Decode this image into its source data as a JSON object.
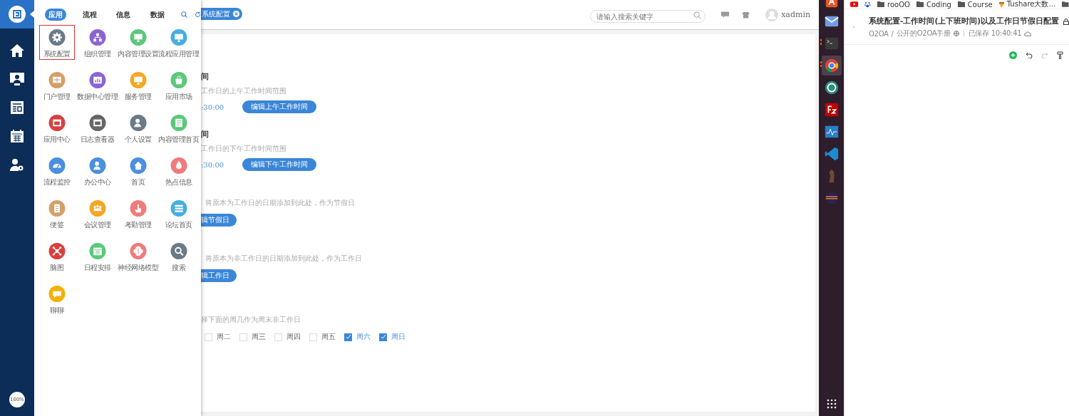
{
  "nav": {
    "zoom": "100%"
  },
  "app_menu": {
    "tabs": [
      {
        "label": "应用",
        "selected": true
      },
      {
        "label": "流程",
        "selected": false
      },
      {
        "label": "信息",
        "selected": false
      },
      {
        "label": "数据",
        "selected": false
      }
    ],
    "apps": [
      {
        "label": "系统配置",
        "kind": "gear",
        "color": "#6b7a87",
        "selected": true
      },
      {
        "label": "组织管理",
        "kind": "org",
        "color": "#8c63d6",
        "selected": false
      },
      {
        "label": "内容管理设置",
        "kind": "monitor",
        "color": "#5cc87a",
        "selected": false
      },
      {
        "label": "流程应用管理",
        "kind": "monitor",
        "color": "#45aee0",
        "selected": false
      },
      {
        "label": "门户管理",
        "kind": "grid",
        "color": "#d4a06a",
        "selected": false
      },
      {
        "label": "数据中心管理",
        "kind": "chart",
        "color": "#8c63d6",
        "selected": false
      },
      {
        "label": "服务管理",
        "kind": "monitor",
        "color": "#f5a623",
        "selected": false
      },
      {
        "label": "应用市场",
        "kind": "bag",
        "color": "#5cc87a",
        "selected": false
      },
      {
        "label": "应用中心",
        "kind": "window",
        "color": "#d84040",
        "selected": false
      },
      {
        "label": "日志查看器",
        "kind": "window",
        "color": "#666666",
        "selected": false
      },
      {
        "label": "个人设置",
        "kind": "person",
        "color": "#6b7a87",
        "selected": false
      },
      {
        "label": "内容管理首页",
        "kind": "doc",
        "color": "#5cc87a",
        "selected": false
      },
      {
        "label": "流程监控",
        "kind": "gauge",
        "color": "#4a8fe0",
        "selected": false
      },
      {
        "label": "办公中心",
        "kind": "person",
        "color": "#4a8fe0",
        "selected": false
      },
      {
        "label": "首页",
        "kind": "home",
        "color": "#4a8fe0",
        "selected": false
      },
      {
        "label": "热点信息",
        "kind": "flame",
        "color": "#f07b7b",
        "selected": false
      },
      {
        "label": "便签",
        "kind": "note",
        "color": "#d4a06a",
        "selected": false
      },
      {
        "label": "会议管理",
        "kind": "people",
        "color": "#f5a623",
        "selected": false
      },
      {
        "label": "考勤管理",
        "kind": "hand",
        "color": "#f07b7b",
        "selected": false
      },
      {
        "label": "论坛首页",
        "kind": "list",
        "color": "#45aee0",
        "selected": false
      },
      {
        "label": "脑图",
        "kind": "network",
        "color": "#d84040",
        "selected": false
      },
      {
        "label": "日程安排",
        "kind": "calendar",
        "color": "#5cc87a",
        "selected": false
      },
      {
        "label": "神经网络模型",
        "kind": "brain",
        "color": "#f07b7b",
        "selected": false
      },
      {
        "label": "搜索",
        "kind": "search",
        "color": "#6b7a87",
        "selected": false
      },
      {
        "label": "聊聊",
        "kind": "chat",
        "color": "#f5b000",
        "selected": false
      }
    ]
  },
  "topbar": {
    "tab": "系统配置",
    "search": {
      "placeholder": "请输入搜索关键字"
    },
    "user": "xadmin"
  },
  "sections": [
    {
      "kind": "time",
      "heading": "间",
      "hint": "工作日的上午工作时间范围",
      "value": ":30:00",
      "button": "编辑上午工作时间"
    },
    {
      "kind": "time",
      "heading": "间",
      "hint": "工作日的下午工作时间范围",
      "value": ":30:00",
      "button": "编辑下午工作时间"
    },
    {
      "kind": "dates",
      "hint": "将原本为工作日的日期添加到此处，作为节假日",
      "button": "辑节假日"
    },
    {
      "kind": "dates",
      "hint": "将原本为非工作日的日期添加到此处，作为工作日",
      "button": "辑工作日"
    },
    {
      "kind": "weekdays",
      "hint": "择下面的周几作为周末非工作日",
      "days": [
        {
          "label": "周二",
          "checked": false
        },
        {
          "label": "周三",
          "checked": false
        },
        {
          "label": "周四",
          "checked": false
        },
        {
          "label": "周五",
          "checked": false
        },
        {
          "label": "周六",
          "checked": true
        },
        {
          "label": "周日",
          "checked": true
        }
      ]
    }
  ],
  "dock": [
    {
      "kind": "store",
      "running": false,
      "selected": false
    },
    {
      "kind": "mail",
      "running": false,
      "selected": false
    },
    {
      "kind": "terminal",
      "running": true,
      "selected": false
    },
    {
      "kind": "browser",
      "running": true,
      "selected": true
    },
    {
      "kind": "sync",
      "running": false,
      "selected": false
    },
    {
      "kind": "transfer",
      "running": false,
      "selected": false
    },
    {
      "kind": "monitor",
      "running": false,
      "selected": false
    },
    {
      "kind": "editor",
      "running": false,
      "selected": false
    },
    {
      "kind": "animal",
      "running": false,
      "selected": false
    },
    {
      "kind": "ring",
      "running": false,
      "selected": false
    }
  ],
  "browser": {
    "bookmarks": [
      {
        "kind": "video"
      },
      {
        "kind": "paw"
      },
      {
        "kind": "folder",
        "label": "rooOO"
      },
      {
        "kind": "folder",
        "label": "Coding"
      },
      {
        "kind": "folder",
        "label": "Course"
      },
      {
        "kind": "acorn",
        "label": "Tushare大数…"
      },
      {
        "kind": "folder"
      }
    ],
    "doc": {
      "title": "系统配置-工作时间(上下班时间)以及工作日节假日配置",
      "space": "O2OA",
      "separator": "/",
      "book": "公开的O2OA手册",
      "saved": "已保存 10:40:41"
    },
    "toolbar": [
      {
        "kind": "add",
        "disabled": false
      },
      {
        "kind": "undo",
        "disabled": false
      },
      {
        "kind": "redo",
        "disabled": true
      },
      {
        "kind": "painter",
        "disabled": false
      }
    ]
  }
}
